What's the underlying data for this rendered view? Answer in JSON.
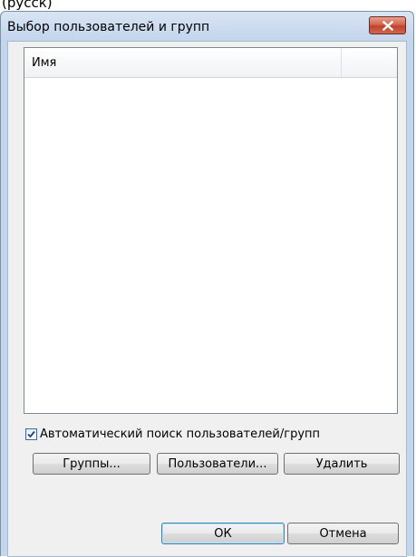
{
  "above_fragment": "(русск)",
  "dialog": {
    "title": "Выбор пользователей и групп"
  },
  "list": {
    "columns": [
      "Имя",
      ""
    ]
  },
  "options": {
    "auto_search_label": "Автоматический поиск пользователей/групп",
    "auto_search_checked": true
  },
  "actions": {
    "groups_label": "Группы...",
    "users_label": "Пользователи...",
    "delete_label": "Удалить"
  },
  "footer": {
    "ok_label": "ОК",
    "cancel_label": "Отмена"
  },
  "colors": {
    "titlebar": "#c3d5ec",
    "close_button": "#c1422a",
    "client_bg": "#f0f0f0",
    "default_button_border": "#3c7fb1"
  }
}
